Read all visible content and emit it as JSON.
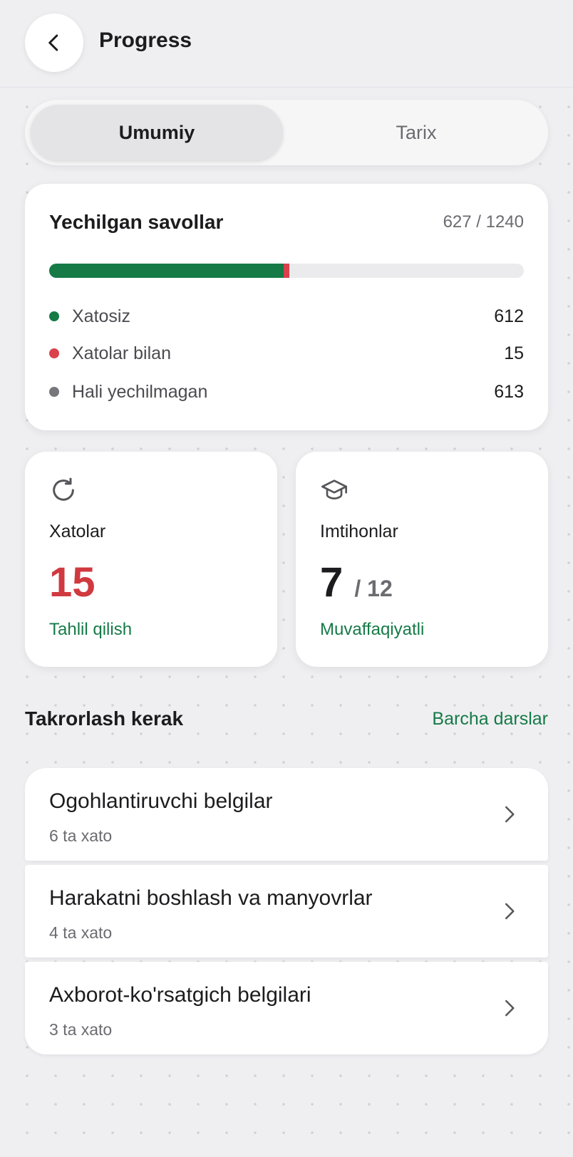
{
  "header": {
    "title": "Progress",
    "back_icon": "chevron-left-icon"
  },
  "tabs": [
    {
      "label": "Umumiy",
      "active": true
    },
    {
      "label": "Tarix",
      "active": false
    }
  ],
  "solved": {
    "title": "Yechilgan savollar",
    "count": "627 / 1240",
    "solved_without_errors": 612,
    "solved_with_errors": 15,
    "total": 1240,
    "legend": [
      {
        "label": "Xatosiz",
        "value": "612",
        "color": "#167a47"
      },
      {
        "label": "Xatolar bilan",
        "value": "15",
        "color": "#d9414b"
      },
      {
        "label": "Hali yechilmagan",
        "value": "613",
        "color": "#76767b"
      }
    ]
  },
  "mistakes": {
    "icon": "refresh-icon",
    "label": "Xatolar",
    "value": "15",
    "link": "Tahlil qilish",
    "value_color": "#d0393f"
  },
  "exams": {
    "icon": "graduation-cap-icon",
    "label": "Imtihonlar",
    "value": "7",
    "total": "/ 12",
    "link": "Muvaffaqiyatli"
  },
  "review": {
    "title": "Takrorlash kerak",
    "link": "Barcha darslar",
    "items": [
      {
        "title": "Ogohlantiruvchi belgilar",
        "subtitle": "6 ta xato"
      },
      {
        "title": "Harakatni boshlash va manyovrlar",
        "subtitle": "4 ta xato"
      },
      {
        "title": "Axborot-ko'rsatgich belgilari",
        "subtitle": "3 ta xato"
      }
    ]
  },
  "colors": {
    "accent_green": "#167a47",
    "error_red": "#d9414b",
    "background": "#efeff2"
  }
}
